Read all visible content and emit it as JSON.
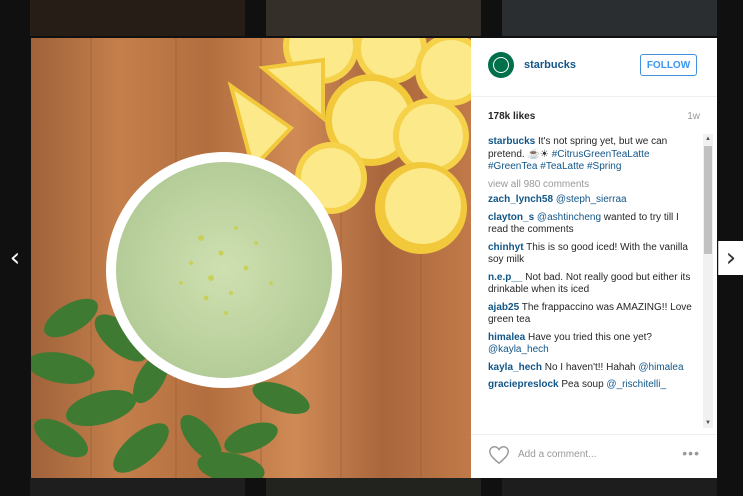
{
  "post": {
    "username": "starbucks",
    "follow_label": "FOLLOW",
    "likes": "178k likes",
    "age": "1w",
    "caption_user": "starbucks",
    "caption_text": "It's not spring yet, but we can pretend. ",
    "caption_emoji": "☕☀",
    "caption_tags": "#CitrusGreenTeaLatte #GreenTea #TeaLatte #Spring",
    "view_all": "view all 980 comments",
    "add_comment_placeholder": "Add a comment...",
    "more_label": "•••"
  },
  "comments": [
    {
      "user": "zach_lynch58",
      "text": "",
      "mention": "@steph_sierraa"
    },
    {
      "user": "clayton_s",
      "text": "",
      "mention": "@ashtincheng",
      "after": " wanted to try till I read the comments"
    },
    {
      "user": "chinhyt",
      "text": " This is so good iced! With the vanilla soy milk"
    },
    {
      "user": "n.e.p__",
      "text": " Not bad. Not really good but either its drinkable when its iced"
    },
    {
      "user": "ajab25",
      "text": " The frappaccino was AMAZING!! Love green tea"
    },
    {
      "user": "himalea",
      "text": " Have you tried this one yet? ",
      "mention": "@kayla_hech"
    },
    {
      "user": "kayla_hech",
      "text": " No I haven't!! Hahah ",
      "mention": "@himalea"
    },
    {
      "user": "graciepreslock",
      "text": " Pea soup ",
      "mention": "@_rischitelli_"
    }
  ],
  "nav": {
    "prev": "‹",
    "next": "›"
  },
  "colors": {
    "accent": "#125688",
    "follow": "#3897f0",
    "avatar": "#00704a"
  }
}
